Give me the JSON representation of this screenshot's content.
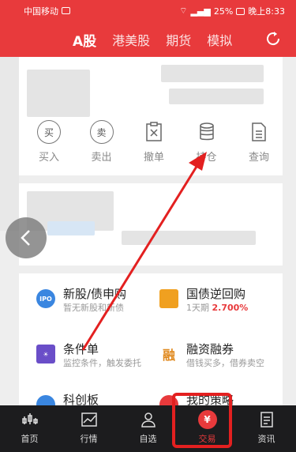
{
  "status_bar": {
    "carrier": "中国移动",
    "battery": "25%",
    "time": "晚上8:33"
  },
  "header": {
    "tabs": [
      {
        "label": "A股"
      },
      {
        "label": "港美股"
      },
      {
        "label": "期货"
      },
      {
        "label": "模拟"
      }
    ],
    "refresh_icon": "refresh-icon"
  },
  "actions": [
    {
      "label": "买入",
      "glyph": "买"
    },
    {
      "label": "卖出",
      "glyph": "卖"
    },
    {
      "label": "撤单",
      "icon": "cancel-order-icon"
    },
    {
      "label": "持仓",
      "icon": "positions-icon"
    },
    {
      "label": "查询",
      "icon": "document-icon"
    }
  ],
  "services": [
    {
      "title": "新股/债申购",
      "sub": "暂无新股和新债",
      "icon_text": "IPO",
      "color": "#3a86e0"
    },
    {
      "title": "国债逆回购",
      "sub_prefix": "1天期 ",
      "sub_highlight": "2.700%",
      "color": "#f0a020"
    },
    {
      "title": "条件单",
      "sub": "监控条件，触发委托",
      "color": "#6a4ec8"
    },
    {
      "title": "融资融券",
      "sub": "借钱买多，借券卖空",
      "icon_text": "融",
      "color": "#e08a20"
    },
    {
      "title": "科创板",
      "color": "#3a86e0"
    },
    {
      "title": "我的策略",
      "color": "#e83a3c"
    }
  ],
  "bottom_nav": [
    {
      "label": "首页",
      "icon": "home-candle-icon"
    },
    {
      "label": "行情",
      "icon": "chart-icon"
    },
    {
      "label": "自选",
      "icon": "user-icon"
    },
    {
      "label": "交易",
      "icon": "yen-icon",
      "glyph": "¥",
      "active": true
    },
    {
      "label": "资讯",
      "icon": "news-icon"
    }
  ],
  "colors": {
    "brand_red": "#e83a3c",
    "nav_bg": "#1c1c1e"
  }
}
